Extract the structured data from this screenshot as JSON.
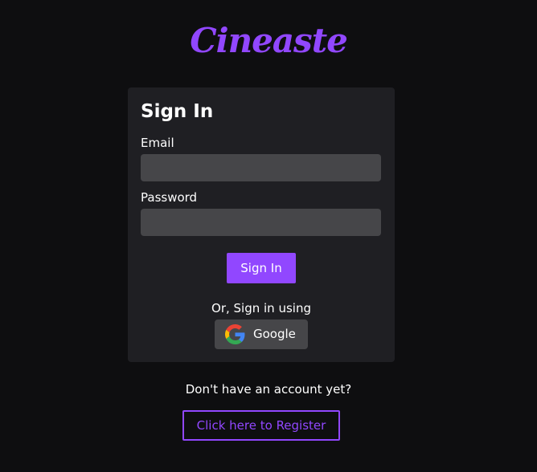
{
  "app": {
    "logo_text": "Cineaste",
    "accent_color": "#9147ff",
    "background_color": "#0e0e10"
  },
  "signin_card": {
    "title": "Sign In",
    "email_label": "Email",
    "email_value": "",
    "password_label": "Password",
    "password_value": "",
    "submit_label": "Sign In",
    "alt_signin_text": "Or, Sign in using",
    "google_button": {
      "label": "Google",
      "icon": "google-logo-icon"
    }
  },
  "register": {
    "prompt": "Don't have an account yet?",
    "link_label": "Click here to Register"
  }
}
